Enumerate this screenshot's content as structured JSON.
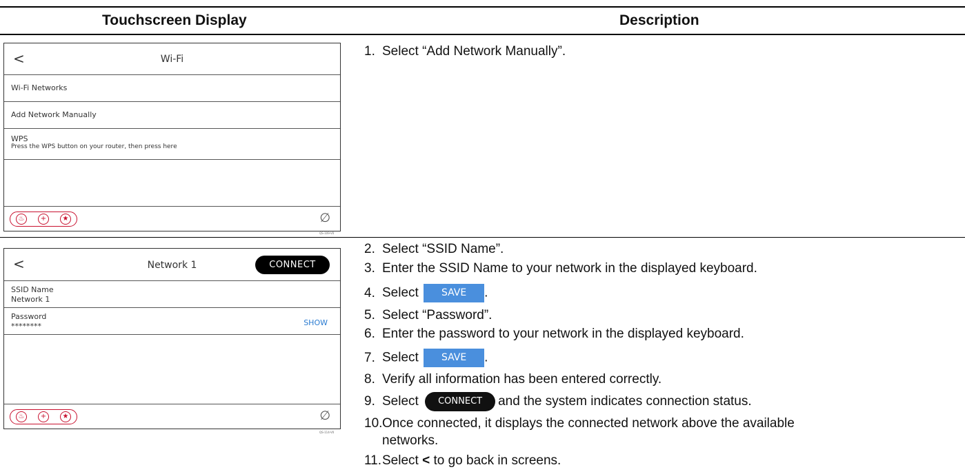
{
  "page": {
    "fragment": "y"
  },
  "headers": {
    "left": "Touchscreen Display",
    "right": "Description"
  },
  "screen1": {
    "back": "<",
    "title": "Wi-Fi",
    "rows": [
      {
        "title": "Wi-Fi Networks"
      },
      {
        "title": "Add Network Manually"
      },
      {
        "title": "WPS",
        "subtitle": "Press the WPS button on your router, then press here"
      }
    ],
    "code": "QS-109-V0"
  },
  "screen2": {
    "back": "<",
    "title": "Network 1",
    "connect": "CONNECT",
    "rows": [
      {
        "label": "SSID Name",
        "value": "Network 1"
      },
      {
        "label": "Password",
        "value": "********",
        "action": "SHOW"
      }
    ],
    "code": "QS-114-V0"
  },
  "footer_icons": [
    "fire-icon",
    "medical-icon",
    "police-icon",
    "no-signal-icon"
  ],
  "colors": {
    "accent_blue": "#4a8fdd",
    "alarm_red": "#c8102e"
  },
  "steps": {
    "s1": {
      "num": "1.",
      "text": "Select “Add Network Manually”."
    },
    "s2": {
      "num": "2.",
      "text": "Select “SSID Name”."
    },
    "s3": {
      "num": "3.",
      "text": "Enter the SSID Name to your network in the displayed keyboard."
    },
    "s4": {
      "num": "4.",
      "pre": "Select",
      "pill": "SAVE",
      "post": "."
    },
    "s5": {
      "num": "5.",
      "text": "Select “Password”."
    },
    "s6": {
      "num": "6.",
      "text": "Enter the password to your network in the displayed keyboard."
    },
    "s7": {
      "num": "7.",
      "pre": "Select",
      "pill": "SAVE",
      "post": "."
    },
    "s8": {
      "num": "8.",
      "text": "Verify all information has been entered correctly."
    },
    "s9": {
      "num": "9.",
      "pre": "Select",
      "pill": "CONNECT",
      "post": "and the system indicates connection status."
    },
    "s10": {
      "num": "10.",
      "line1": "Once connected, it displays the connected network above the available",
      "line2": "networks."
    },
    "s11": {
      "num": "11.",
      "pre": "Select",
      "bold": "<",
      "post": "to go back in screens."
    }
  }
}
